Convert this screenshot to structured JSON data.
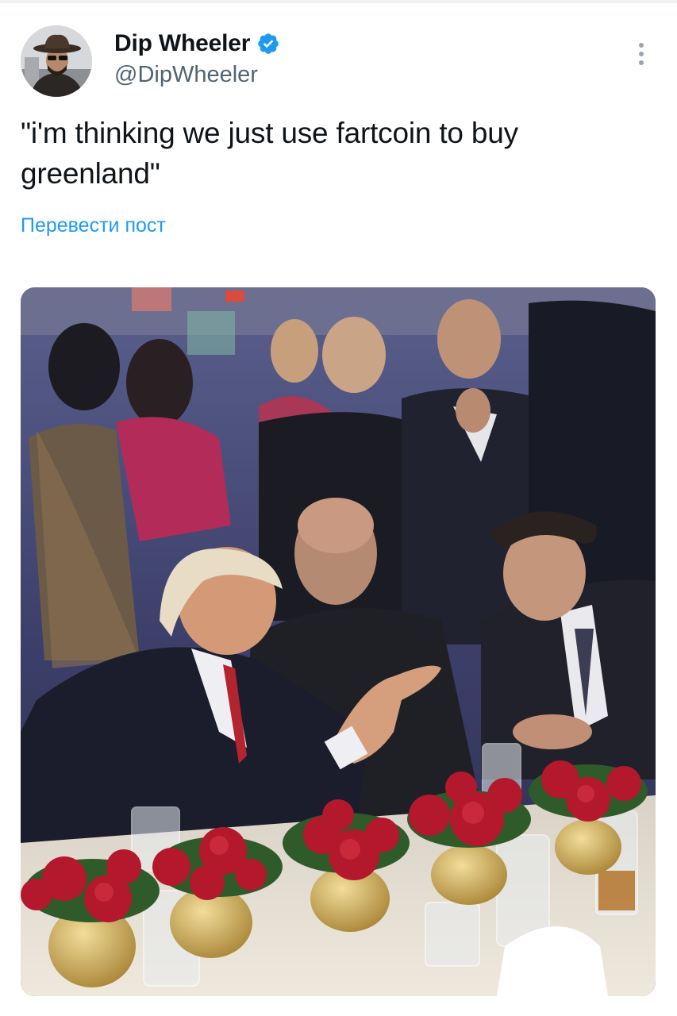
{
  "tweet": {
    "author": {
      "display_name": "Dip Wheeler",
      "handle": "@DipWheeler",
      "verified": true,
      "verified_color": "#1d9bf0"
    },
    "text": "\"i'm thinking we just use fartcoin to buy greenland\"",
    "translate_label": "Перевести пост",
    "media": {
      "type": "photo"
    }
  },
  "colors": {
    "link": "#1d9bf0",
    "secondary_text": "#536471",
    "primary_text": "#0f1419"
  },
  "icons": {
    "verified": "verified-badge-icon",
    "more": "more-vertical-icon"
  }
}
